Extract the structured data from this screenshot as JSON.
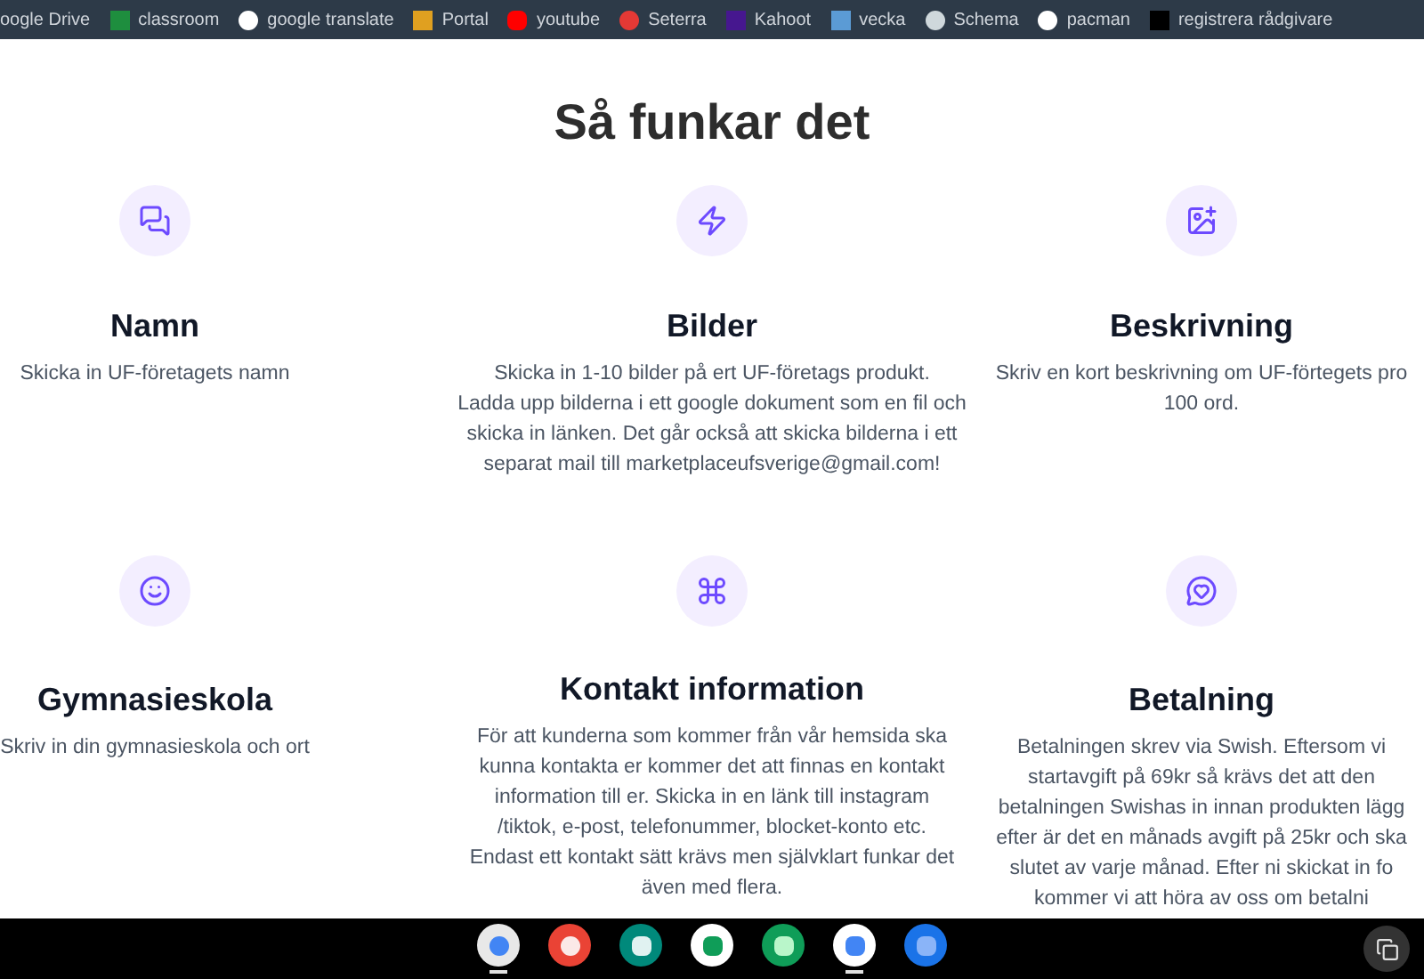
{
  "bookmarks": [
    {
      "label": "oogle Drive"
    },
    {
      "label": "classroom"
    },
    {
      "label": "google translate"
    },
    {
      "label": "Portal"
    },
    {
      "label": "youtube"
    },
    {
      "label": "Seterra"
    },
    {
      "label": "Kahoot"
    },
    {
      "label": "vecka"
    },
    {
      "label": "Schema"
    },
    {
      "label": "pacman"
    },
    {
      "label": "registrera rådgivare"
    }
  ],
  "heading": "Så funkar det",
  "steps": [
    {
      "title": "Namn",
      "lines": [
        "Skicka in UF-företagets namn"
      ]
    },
    {
      "title": "Bilder",
      "lines": [
        "Skicka in 1-10 bilder på ert UF-företags produkt.",
        "Ladda upp bilderna i ett google dokument som en fil och",
        "skicka in länken. Det går också att skicka bilderna i ett",
        "separat mail till marketplaceufsverige@gmail.com!"
      ]
    },
    {
      "title": "Beskrivning",
      "lines": [
        "Skriv en kort beskrivning om UF-förtegets pro",
        "100 ord."
      ]
    },
    {
      "title": "Gymnasieskola",
      "lines": [
        "Skriv in din gymnasieskola och ort"
      ]
    },
    {
      "title": "Kontakt information",
      "lines": [
        "För att kunderna som kommer från vår hemsida ska",
        "kunna kontakta er kommer det att finnas en kontakt",
        "information till er. Skicka in en länk till instagram",
        "/tiktok, e-post, telefonummer, blocket-konto etc.",
        "Endast ett kontakt sätt krävs men självklart funkar det",
        "även med flera."
      ]
    },
    {
      "title": "Betalning",
      "lines": [
        "Betalningen skrev via Swish. Eftersom vi",
        "startavgift på 69kr så krävs det att den",
        "betalningen Swishas in innan produkten lägg",
        "efter är det en månads avgift på 25kr och ska",
        "slutet av varje månad. Efter ni skickat in fo",
        "kommer vi att höra av oss om betalni"
      ]
    }
  ],
  "taskbar": {
    "apps": [
      {
        "open": true
      },
      {
        "open": false
      },
      {
        "open": false
      },
      {
        "open": false
      },
      {
        "open": false
      },
      {
        "open": true
      },
      {
        "open": false
      }
    ]
  }
}
